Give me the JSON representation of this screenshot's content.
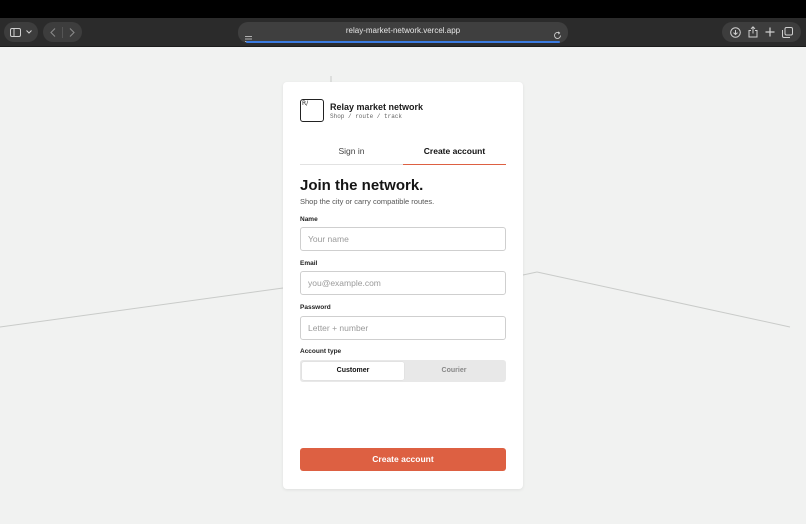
{
  "browser": {
    "url": "relay-market-network.vercel.app",
    "icons": [
      "sidebar-icon",
      "chevron-down-icon",
      "back-icon",
      "forward-icon",
      "reader-icon",
      "reload-icon",
      "download-icon",
      "share-icon",
      "new-tab-icon",
      "tabs-overview-icon"
    ]
  },
  "brand": {
    "logo_mark": "R/",
    "name": "Relay market network",
    "tagline": "Shop / route / track"
  },
  "tabs": {
    "sign_in": "Sign in",
    "create_account": "Create account",
    "active": "create_account"
  },
  "form": {
    "heading": "Join the network.",
    "subheading": "Shop the city or carry compatible routes.",
    "name_label": "Name",
    "name_placeholder": "Your name",
    "email_label": "Email",
    "email_placeholder": "you@example.com",
    "password_label": "Password",
    "password_placeholder": "Letter + number",
    "account_type_label": "Account type",
    "account_types": [
      "Customer",
      "Courier"
    ],
    "account_type_selected": "Customer",
    "submit_label": "Create account"
  },
  "colors": {
    "accent": "#dd6042",
    "page_background": "#f1f2f1",
    "browser_chrome": "#2b2b2b"
  }
}
